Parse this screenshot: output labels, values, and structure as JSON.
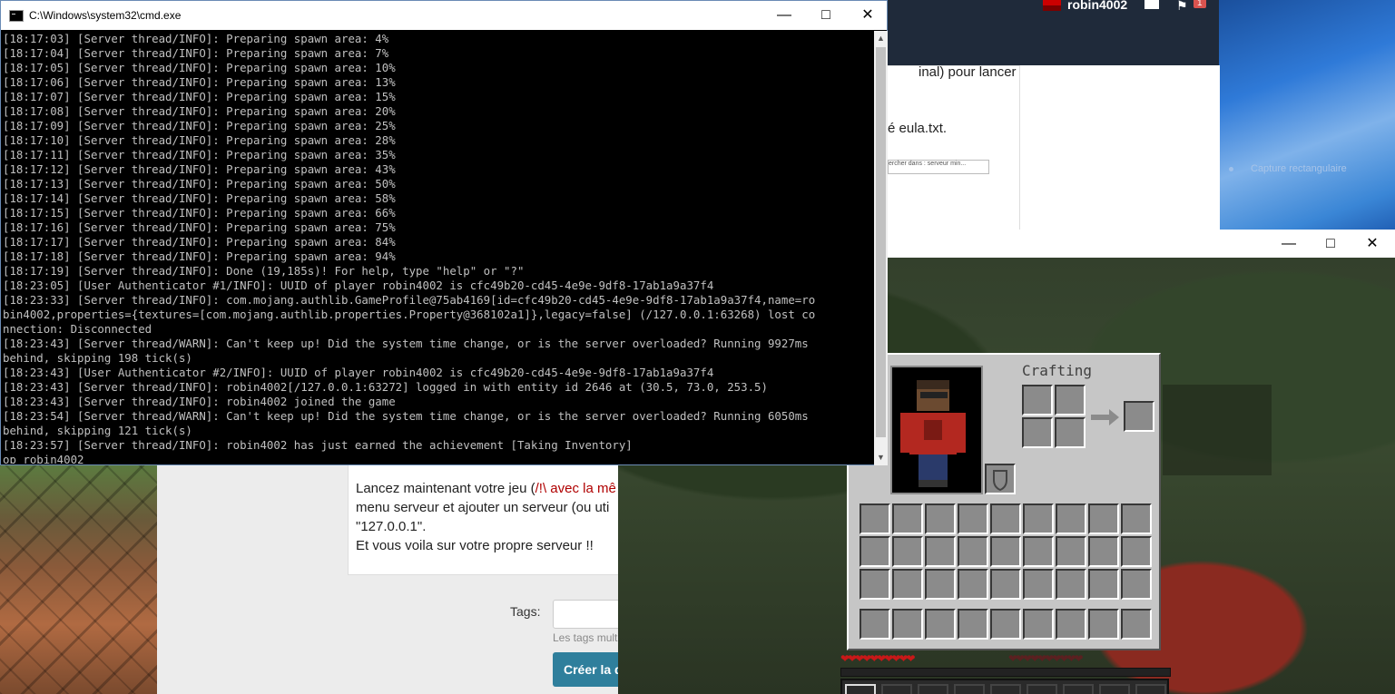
{
  "desktop": {
    "label": "Capture rectangulaire"
  },
  "webpage": {
    "nav": {
      "username": "robin4002",
      "badge": "1"
    },
    "snippets": {
      "top1": "inal) pour lancer",
      "top2": "é eula.txt.",
      "search_placeholder": "ercher dans : serveur min...",
      "p1_a": "Lancez maintenant votre jeu (",
      "p1_b": "/!\\ avec la mê",
      "p2": "menu serveur et ajouter un serveur (ou uti",
      "p3": "\"127.0.0.1\".",
      "p4": "Et vous voila sur votre propre serveur !!"
    },
    "tags_label": "Tags:",
    "tags_help": "Les tags mult",
    "create_button": "Créer la d"
  },
  "cmd": {
    "title": "C:\\Windows\\system32\\cmd.exe",
    "lines": [
      "[18:17:03] [Server thread/INFO]: Preparing spawn area: 4%",
      "[18:17:04] [Server thread/INFO]: Preparing spawn area: 7%",
      "[18:17:05] [Server thread/INFO]: Preparing spawn area: 10%",
      "[18:17:06] [Server thread/INFO]: Preparing spawn area: 13%",
      "[18:17:07] [Server thread/INFO]: Preparing spawn area: 15%",
      "[18:17:08] [Server thread/INFO]: Preparing spawn area: 20%",
      "[18:17:09] [Server thread/INFO]: Preparing spawn area: 25%",
      "[18:17:10] [Server thread/INFO]: Preparing spawn area: 28%",
      "[18:17:11] [Server thread/INFO]: Preparing spawn area: 35%",
      "[18:17:12] [Server thread/INFO]: Preparing spawn area: 43%",
      "[18:17:13] [Server thread/INFO]: Preparing spawn area: 50%",
      "[18:17:14] [Server thread/INFO]: Preparing spawn area: 58%",
      "[18:17:15] [Server thread/INFO]: Preparing spawn area: 66%",
      "[18:17:16] [Server thread/INFO]: Preparing spawn area: 75%",
      "[18:17:17] [Server thread/INFO]: Preparing spawn area: 84%",
      "[18:17:18] [Server thread/INFO]: Preparing spawn area: 94%",
      "[18:17:19] [Server thread/INFO]: Done (19,185s)! For help, type \"help\" or \"?\"",
      "[18:23:05] [User Authenticator #1/INFO]: UUID of player robin4002 is cfc49b20-cd45-4e9e-9df8-17ab1a9a37f4",
      "[18:23:33] [Server thread/INFO]: com.mojang.authlib.GameProfile@75ab4169[id=cfc49b20-cd45-4e9e-9df8-17ab1a9a37f4,name=ro",
      "bin4002,properties={textures=[com.mojang.authlib.properties.Property@368102a1]},legacy=false] (/127.0.0.1:63268) lost co",
      "nnection: Disconnected",
      "[18:23:43] [Server thread/WARN]: Can't keep up! Did the system time change, or is the server overloaded? Running 9927ms",
      "behind, skipping 198 tick(s)",
      "[18:23:43] [User Authenticator #2/INFO]: UUID of player robin4002 is cfc49b20-cd45-4e9e-9df8-17ab1a9a37f4",
      "[18:23:43] [Server thread/INFO]: robin4002[/127.0.0.1:63272] logged in with entity id 2646 at (30.5, 73.0, 253.5)",
      "[18:23:43] [Server thread/INFO]: robin4002 joined the game",
      "[18:23:54] [Server thread/WARN]: Can't keep up! Did the system time change, or is the server overloaded? Running 6050ms",
      "behind, skipping 121 tick(s)",
      "[18:23:57] [Server thread/INFO]: robin4002 has just earned the achievement [Taking Inventory]",
      "op robin4002"
    ]
  },
  "minecraft": {
    "crafting_label": "Crafting",
    "inventory_rows": 3,
    "inventory_cols": 9,
    "hotbar_slots": 9,
    "selected_hotbar": 0
  },
  "icons": {
    "minimize": "minimize-icon",
    "maximize": "maximize-icon",
    "close": "close-icon"
  }
}
